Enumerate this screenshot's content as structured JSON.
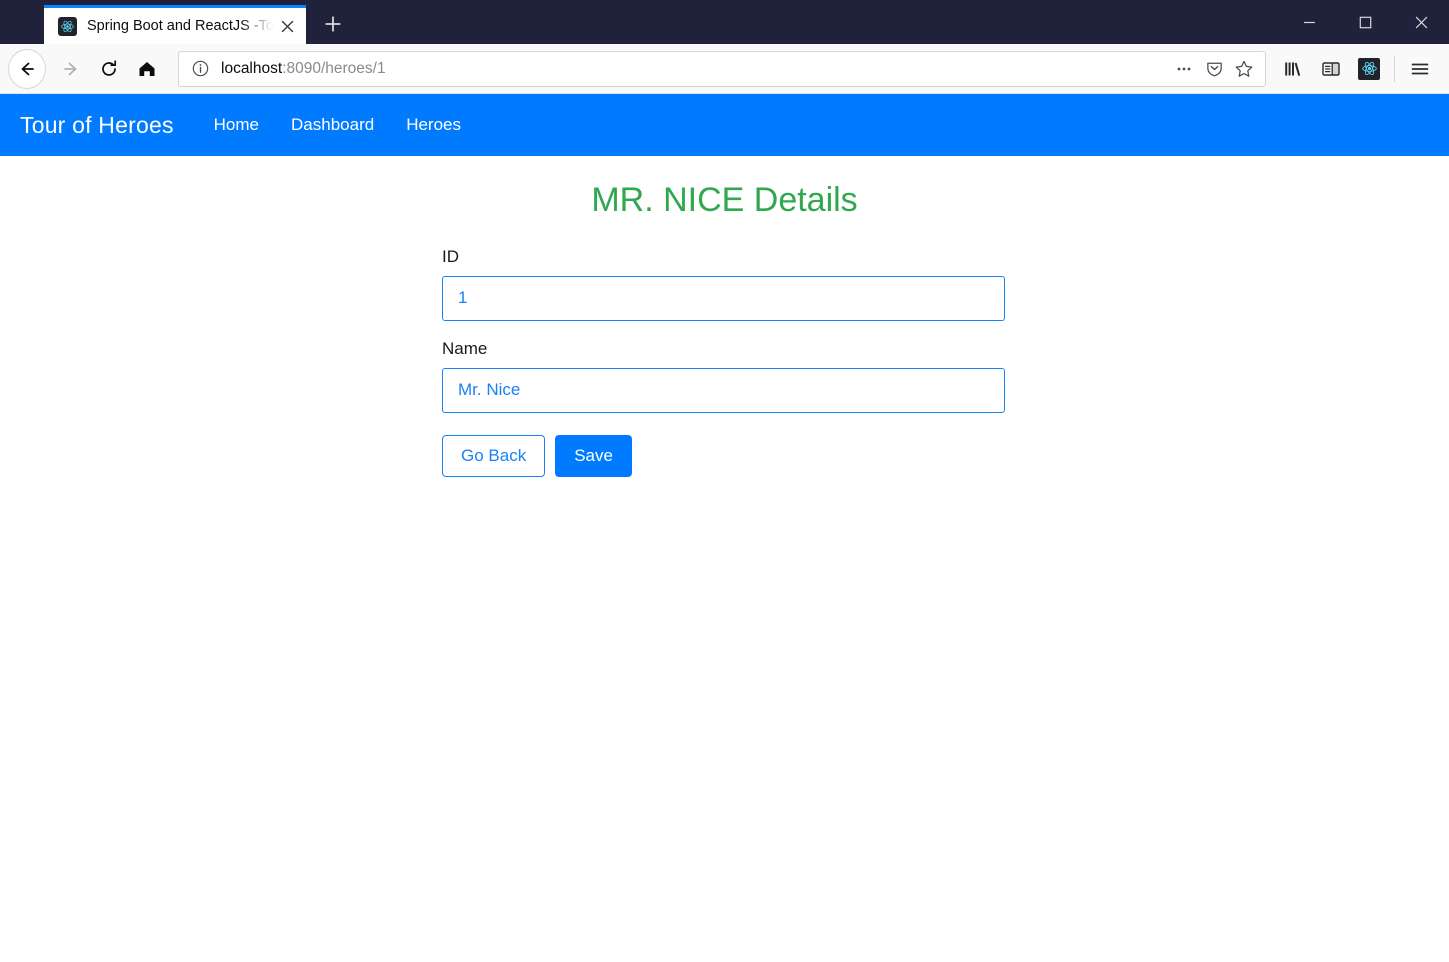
{
  "browser": {
    "tab": {
      "title": "Spring Boot and ReactJS -Tour of Heroes",
      "favicon_icon": "react-favicon",
      "close_icon": "close-icon"
    },
    "new_tab_label": "+",
    "window_controls": {
      "minimize": "minimize-icon",
      "maximize": "maximize-icon",
      "close": "close-icon"
    },
    "nav": {
      "back_icon": "arrow-left-icon",
      "forward_icon": "arrow-right-icon",
      "reload_icon": "reload-icon",
      "home_icon": "home-icon"
    },
    "url": {
      "identity_icon": "info-circle-icon",
      "host": "localhost",
      "path": ":8090/heroes/1",
      "full": "localhost:8090/heroes/1",
      "page_actions_icon": "ellipsis-icon",
      "pocket_icon": "pocket-shield-icon",
      "bookmark_icon": "star-icon"
    },
    "toolbar_right": {
      "library_icon": "library-icon",
      "sidebar_icon": "sidebar-icon",
      "extension_icon": "react-devtools-icon",
      "menu_icon": "hamburger-menu-icon"
    }
  },
  "app": {
    "brand": "Tour of Heroes",
    "nav_links": [
      {
        "label": "Home"
      },
      {
        "label": "Dashboard"
      },
      {
        "label": "Heroes"
      }
    ],
    "heading": "MR. NICE Details",
    "heading_color": "#2fa84f",
    "accent_color": "#007bff",
    "form": {
      "fields": [
        {
          "label": "ID",
          "value": "1",
          "placeholder": ""
        },
        {
          "label": "Name",
          "value": "Mr. Nice",
          "placeholder": ""
        }
      ],
      "buttons": {
        "go_back": "Go Back",
        "save": "Save"
      }
    }
  }
}
